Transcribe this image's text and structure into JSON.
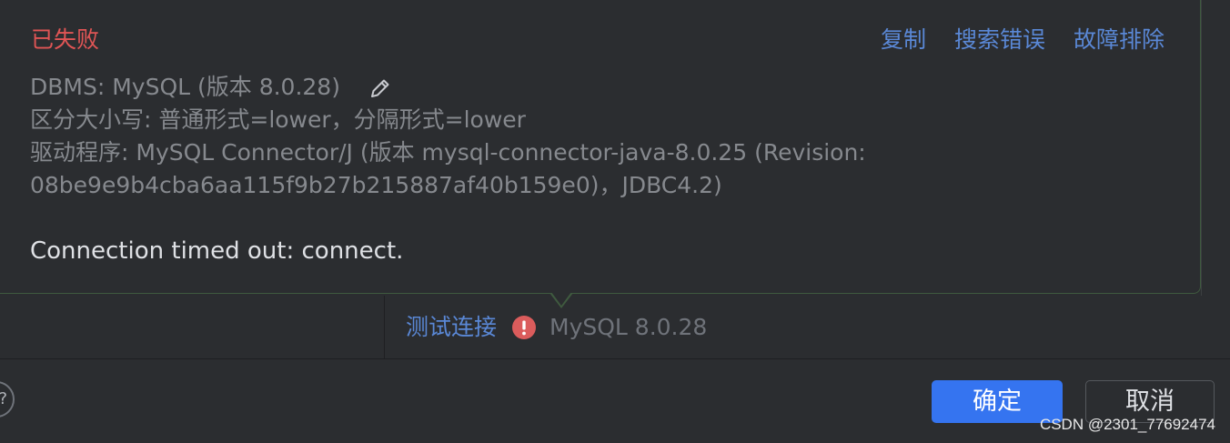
{
  "popup": {
    "status": "已失败",
    "actions": {
      "copy": "复制",
      "search_error": "搜索错误",
      "troubleshoot": "故障排除"
    },
    "info_lines": [
      "DBMS: MySQL (版本 8.0.28)",
      "区分大小写: 普通形式=lower，分隔形式=lower",
      "驱动程序: MySQL Connector/J (版本 mysql-connector-java-8.0.25 (Revision:",
      "08be9e9b4cba6aa115f9b27b215887af40b159e0)，JDBC4.2)"
    ],
    "error_message": "Connection timed out: connect."
  },
  "test_connection": {
    "label": "测试连接",
    "status_icon": "error-icon",
    "db_version": "MySQL 8.0.28"
  },
  "footer": {
    "help_label": "?",
    "ok_label": "确定",
    "cancel_label": "取消"
  },
  "watermark": "CSDN @2301_77692474",
  "colors": {
    "background": "#2b2d30",
    "error": "#e05555",
    "link": "#5a88d6",
    "primary_button": "#3574f0"
  }
}
